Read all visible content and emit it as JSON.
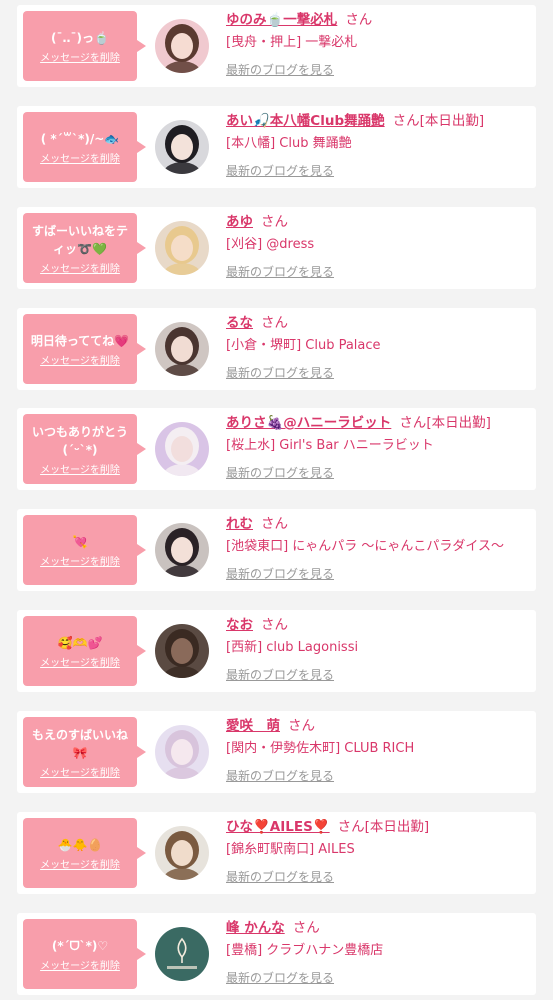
{
  "labels": {
    "delete": "メッセージを削除",
    "blog": "最新のブログを見る"
  },
  "messages": [
    {
      "message": "(¯‥¯)っ🍵",
      "name": "ゆのみ🍵一撃必札",
      "honorific": "さん",
      "status": "",
      "shop": "[曳舟・押上] 一撃必札",
      "avatar": {
        "icon": "avatar-photo",
        "bg": "#f0c9cf",
        "face": "#f6dcd2",
        "hair": "#5a3a30"
      }
    },
    {
      "message": "( *´꒳`*)/~🐟",
      "name": "あい🎣本八幡Club舞踊艶",
      "honorific": "さん",
      "status": "[本日出勤]",
      "shop": "[本八幡] Club 舞踊艶",
      "avatar": {
        "icon": "avatar-photo",
        "bg": "#d8d8dc",
        "face": "#f3e2da",
        "hair": "#1f1d22"
      }
    },
    {
      "message": "すばーいいねをティッ➰💚",
      "name": "あゆ",
      "honorific": "さん",
      "status": "",
      "shop": "[刈谷] @dress",
      "avatar": {
        "icon": "avatar-photo",
        "bg": "#e8d9c8",
        "face": "#f5ddc8",
        "hair": "#e8c98e"
      }
    },
    {
      "message": "明日待っててね💗",
      "name": "るな",
      "honorific": "さん",
      "status": "",
      "shop": "[小倉・堺町] Club Palace",
      "avatar": {
        "icon": "avatar-photo",
        "bg": "#cfc6c2",
        "face": "#f1dcd3",
        "hair": "#4a3530"
      }
    },
    {
      "message": "いつもありがとう(´ᵕ`*)",
      "name": "ありさ🍇@ハニーラビット",
      "honorific": "さん",
      "status": "[本日出勤]",
      "shop": "[桜上水] Girl's Bar ハニーラビット",
      "avatar": {
        "icon": "avatar-photo",
        "bg": "#d9c4e6",
        "face": "#f2dedd",
        "hair": "#f4eef2"
      }
    },
    {
      "message": "💘",
      "name": "れむ",
      "honorific": "さん",
      "status": "",
      "shop": "[池袋東口] にゃんパラ 〜にゃんこパラダイス〜",
      "avatar": {
        "icon": "avatar-photo",
        "bg": "#c9c2bf",
        "face": "#f3e0d8",
        "hair": "#2a2226"
      }
    },
    {
      "message": "🥰🫶💕",
      "name": "なお",
      "honorific": "さん",
      "status": "",
      "shop": "[西新] club Lagonissi",
      "avatar": {
        "icon": "avatar-photo",
        "bg": "#5a4a42",
        "face": "#8a6a5a",
        "hair": "#3a2a22"
      }
    },
    {
      "message": "もえのすばいいね🎀",
      "name": "愛咲　萌",
      "honorific": "さん",
      "status": "",
      "shop": "[関内・伊勢佐木町] CLUB RICH",
      "avatar": {
        "icon": "avatar-photo",
        "bg": "#e6dff0",
        "face": "#f5e8ee",
        "hair": "#d8c4dc"
      }
    },
    {
      "message": "🐣🐥🥚",
      "name": "ひな❣️AILES❣️",
      "honorific": "さん",
      "status": "[本日出勤]",
      "shop": "[錦糸町駅南口] AILES",
      "avatar": {
        "icon": "avatar-photo",
        "bg": "#e7e3dc",
        "face": "#f0dccb",
        "hair": "#7a5a40"
      }
    },
    {
      "message": "(*ˊᗜˋ*)♡",
      "name": "峰 かんな",
      "honorific": "さん",
      "status": "",
      "shop": "[豊橋] クラブハナン豊橋店",
      "avatar": {
        "icon": "club-logo",
        "bg": "#3a6a63",
        "face": "#3a6a63",
        "hair": "#3a6a63"
      }
    }
  ]
}
